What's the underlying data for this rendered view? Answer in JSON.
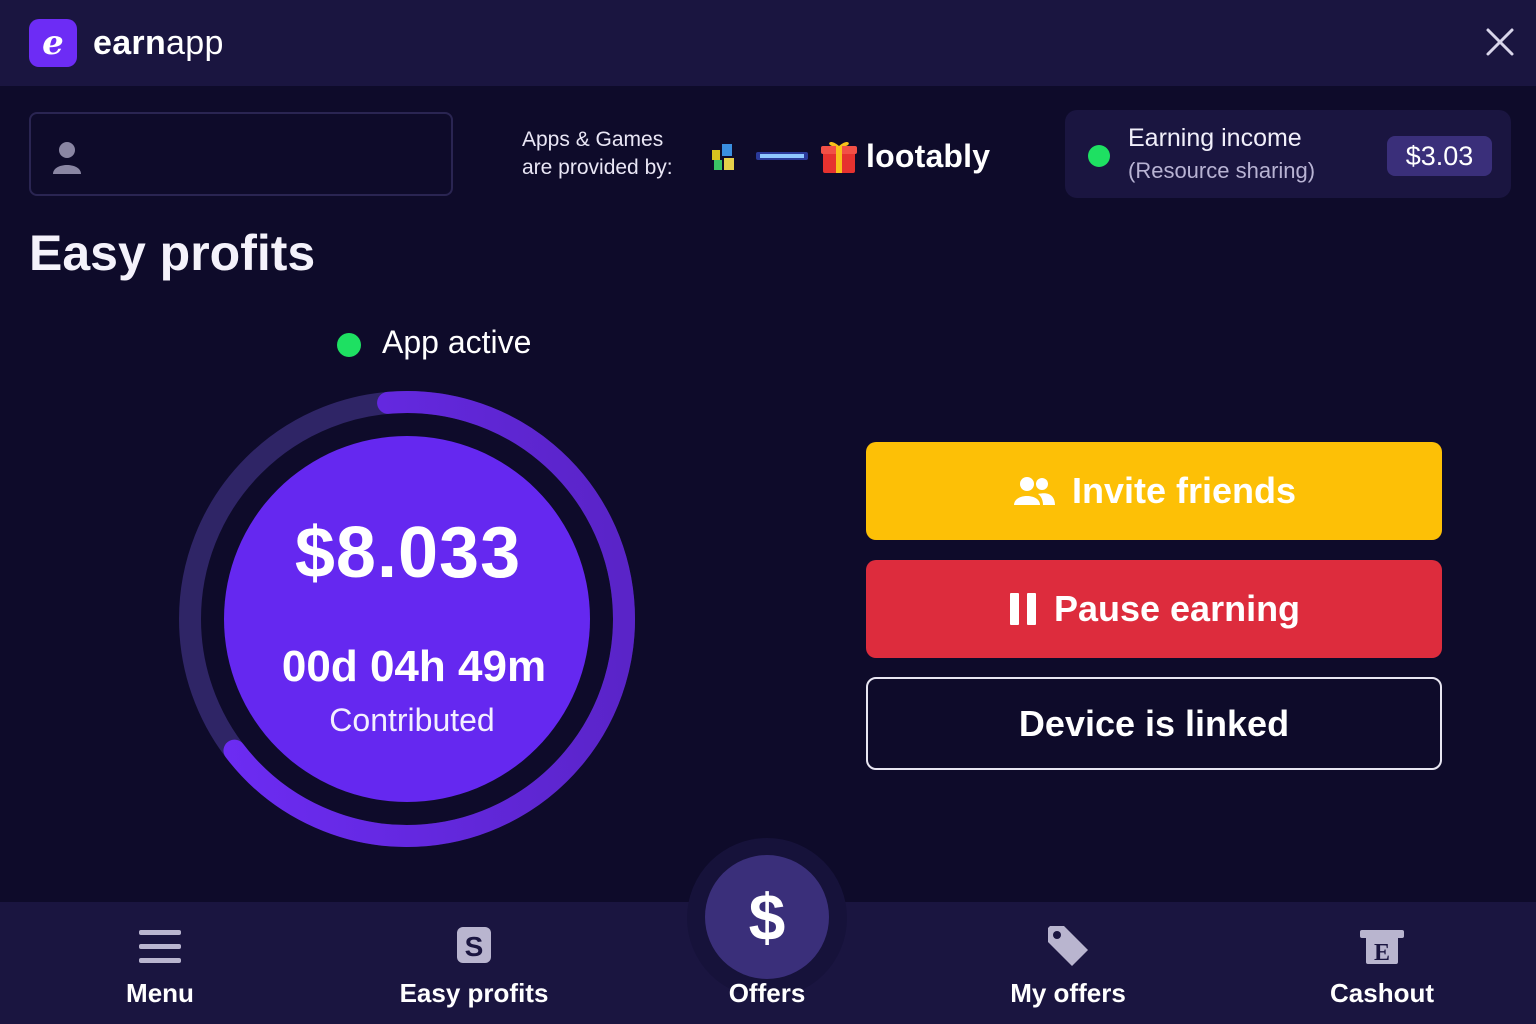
{
  "header": {
    "logo_letter": "e",
    "brand_part1": "earn",
    "brand_part2": "app",
    "close_icon": "close-icon"
  },
  "providers": {
    "label_line1": "Apps & Games",
    "label_line2": "are provided by:",
    "lootably": "lootably"
  },
  "earning": {
    "title": "Earning income",
    "subtitle": "(Resource sharing)",
    "amount": "$3.03",
    "status_color": "#1ee062"
  },
  "page": {
    "title": "Easy profits"
  },
  "status": {
    "label": "App active"
  },
  "progress": {
    "amount": "$8.033",
    "time": "00d 04h 49m",
    "caption": "Contributed",
    "ring_fraction": 0.66
  },
  "actions": {
    "invite": "Invite friends",
    "pause": "Pause earning",
    "linked": "Device is linked"
  },
  "nav": {
    "menu": "Menu",
    "easy_profits": "Easy profits",
    "offers": "Offers",
    "offers_symbol": "$",
    "my_offers": "My offers",
    "cashout": "Cashout"
  },
  "colors": {
    "background": "#0e0b2a",
    "bar": "#1a1540",
    "accent": "#6d2cf5",
    "invite": "#fdc006",
    "pause": "#dd2c3d"
  }
}
